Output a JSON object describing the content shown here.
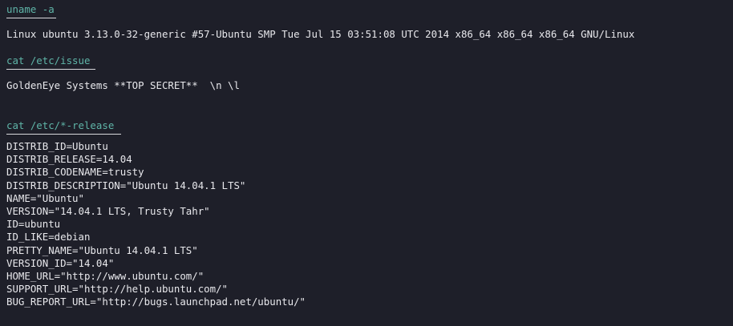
{
  "terminal": {
    "blocks": [
      {
        "command": "uname -a",
        "output": "Linux ubuntu 3.13.0-32-generic #57-Ubuntu SMP Tue Jul 15 03:51:08 UTC 2014 x86_64 x86_64 x86_64 GNU/Linux"
      },
      {
        "command": "cat /etc/issue",
        "output": "GoldenEye Systems **TOP SECRET**  \\n \\l"
      },
      {
        "command": "cat /etc/*-release",
        "output": "DISTRIB_ID=Ubuntu\nDISTRIB_RELEASE=14.04\nDISTRIB_CODENAME=trusty\nDISTRIB_DESCRIPTION=\"Ubuntu 14.04.1 LTS\"\nNAME=\"Ubuntu\"\nVERSION=\"14.04.1 LTS, Trusty Tahr\"\nID=ubuntu\nID_LIKE=debian\nPRETTY_NAME=\"Ubuntu 14.04.1 LTS\"\nVERSION_ID=\"14.04\"\nHOME_URL=\"http://www.ubuntu.com/\"\nSUPPORT_URL=\"http://help.ubuntu.com/\"\nBUG_REPORT_URL=\"http://bugs.launchpad.net/ubuntu/\""
      }
    ]
  },
  "colors": {
    "background": "#1e1f29",
    "command": "#5fb5a8",
    "output": "#e8e8ec"
  }
}
